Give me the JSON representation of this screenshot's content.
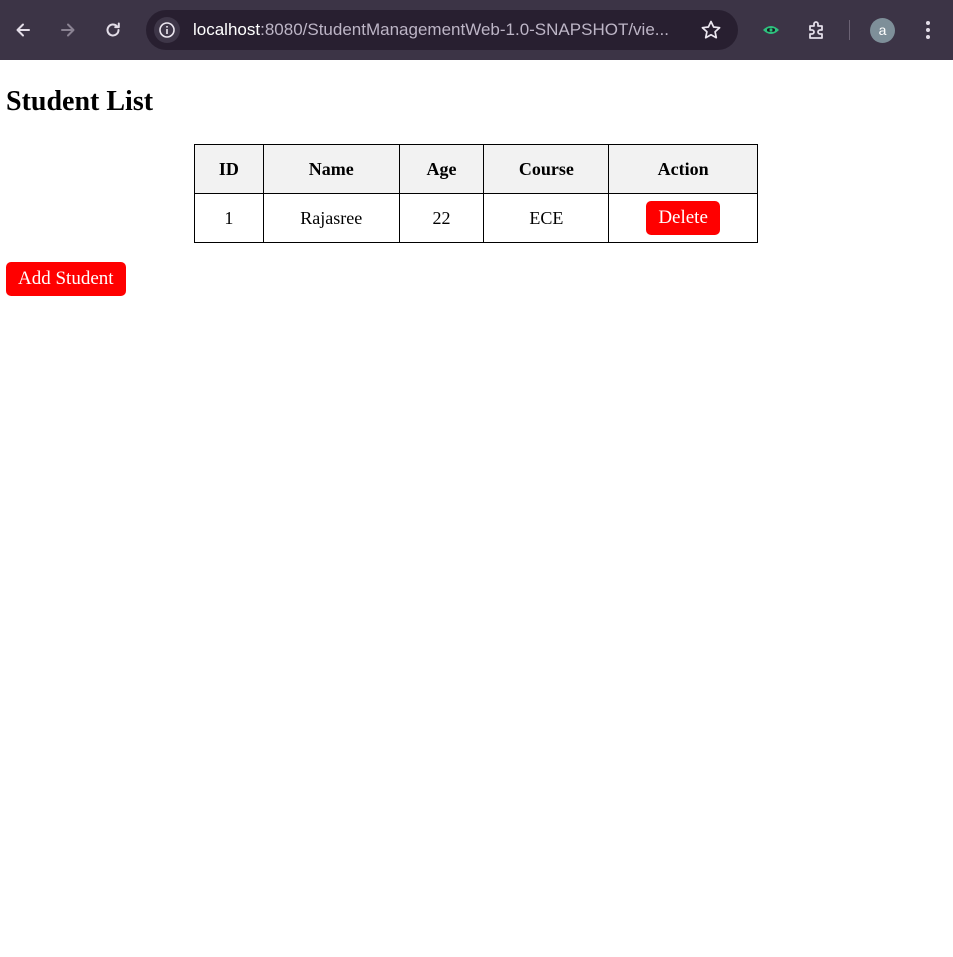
{
  "browser": {
    "url_host": "localhost",
    "url_rest": ":8080/StudentManagementWeb-1.0-SNAPSHOT/vie...",
    "avatar_letter": "a",
    "icons": [
      "back-arrow-icon",
      "forward-arrow-icon",
      "reload-icon",
      "site-info-icon",
      "bookmark-star-icon",
      "extension-eye-icon",
      "extensions-puzzle-icon",
      "more-menu-icon"
    ]
  },
  "page": {
    "title": "Student List"
  },
  "table": {
    "headers": {
      "id": "ID",
      "name": "Name",
      "age": "Age",
      "course": "Course",
      "action": "Action"
    },
    "rows": [
      {
        "id": "1",
        "name": "Rajasree",
        "age": "22",
        "course": "ECE",
        "action_label": "Delete"
      }
    ]
  },
  "actions": {
    "add_label": "Add Student"
  },
  "colors": {
    "accent_red": "#ff0000",
    "header_bg": "#f2f2f2",
    "chrome_bg": "#3c3446",
    "omnibox_bg": "#281f30"
  }
}
